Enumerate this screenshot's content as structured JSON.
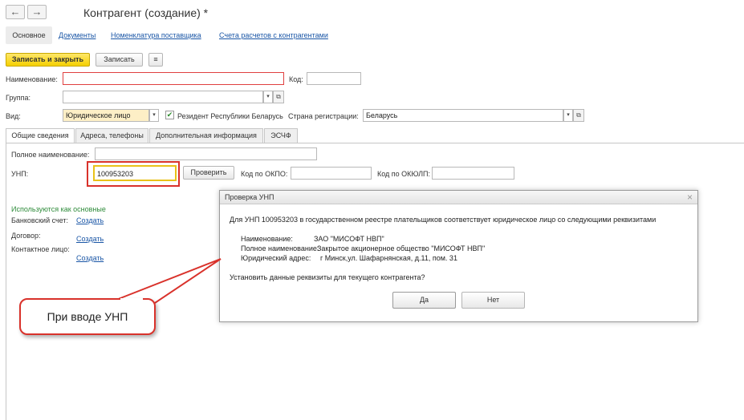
{
  "header": {
    "title": "Контрагент (создание) *",
    "back_icon": "←",
    "forward_icon": "→"
  },
  "tabs": [
    "Основное",
    "Документы",
    "Номенклатура поставщика",
    "Счета расчетов с контрагентами"
  ],
  "toolbar": {
    "save_close": "Записать и закрыть",
    "save": "Записать",
    "more_icon": "≡"
  },
  "form": {
    "name_label": "Наименование:",
    "name_value": "",
    "code_label": "Код:",
    "code_value": "",
    "group_label": "Группа:",
    "group_value": "",
    "kind_label": "Вид:",
    "kind_value": "Юридическое лицо",
    "resident_label": "Резидент Республики Беларусь",
    "resident_checked": true,
    "country_label": "Страна регистрации:",
    "country_value": "Беларусь"
  },
  "subtabs": [
    "Общие сведения",
    "Адреса, телефоны",
    "Дополнительная информация",
    "ЭСЧФ"
  ],
  "general": {
    "fullname_label": "Полное наименование:",
    "fullname_value": "",
    "unp_label": "УНП:",
    "unp_value": "100953203",
    "check_button": "Проверить",
    "okpo_label": "Код по ОКПО:",
    "okpo_value": "",
    "okyulp_label": "Код по ОКЮЛП:",
    "okyulp_value": "",
    "used_as_main": "Используются как основные",
    "bank_label": "Банковский счет:",
    "contract_label": "Договор:",
    "contact_label": "Контактное лицо:",
    "create_link": "Создать"
  },
  "dialog": {
    "title": "Проверка УНП",
    "close_icon": "×",
    "message": "Для УНП 100953203 в государственном реестре плательщиков соответствует юридическое лицо со следующими реквизитами",
    "name_label": "Наименование:",
    "name_value": "ЗАО \"МИСОФТ НВП\"",
    "fullname_label": "Полное наименование:",
    "fullname_value": "Закрытое акционерное общество \"МИСОФТ НВП\"",
    "address_label": "Юридический адрес:",
    "address_value": "г Минск,ул. Шафарнянская, д.11, пом. 31",
    "question": "Установить данные реквизиты для текущего контрагента?",
    "yes": "Да",
    "no": "Нет"
  },
  "callout": {
    "text": "При вводе УНП"
  },
  "colors": {
    "accent_yellow": "#f5d000",
    "highlight_red": "#d9322b",
    "link_blue": "#1a56a6",
    "green_text": "#2e8b3a"
  }
}
